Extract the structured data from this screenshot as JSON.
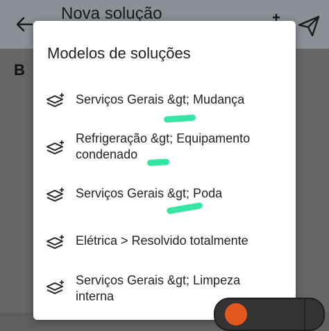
{
  "app": {
    "title": "Nova solução",
    "section_letter": "B"
  },
  "icons": {
    "back": "arrow-left-icon",
    "add": "add-template-icon",
    "send": "send-icon",
    "option": "layers-plus-icon"
  },
  "dialog": {
    "title": "Modelos de soluções",
    "options": [
      {
        "line1": "Serviços Gerais &gt; Mudança",
        "line2": ""
      },
      {
        "line1": "Refrigeração &gt; Equipamento",
        "line2": "condenado"
      },
      {
        "line1": "Serviços Gerais &gt; Poda",
        "line2": ""
      },
      {
        "line1": "Elétrica > Resolvido totalmente",
        "line2": ""
      },
      {
        "line1": "Serviços Gerais &gt; Limpeza",
        "line2": "interna"
      }
    ]
  },
  "colors": {
    "highlight_marks": "#35e6a2",
    "fab_accent": "#e2581d",
    "appbar": "#8a9096"
  }
}
